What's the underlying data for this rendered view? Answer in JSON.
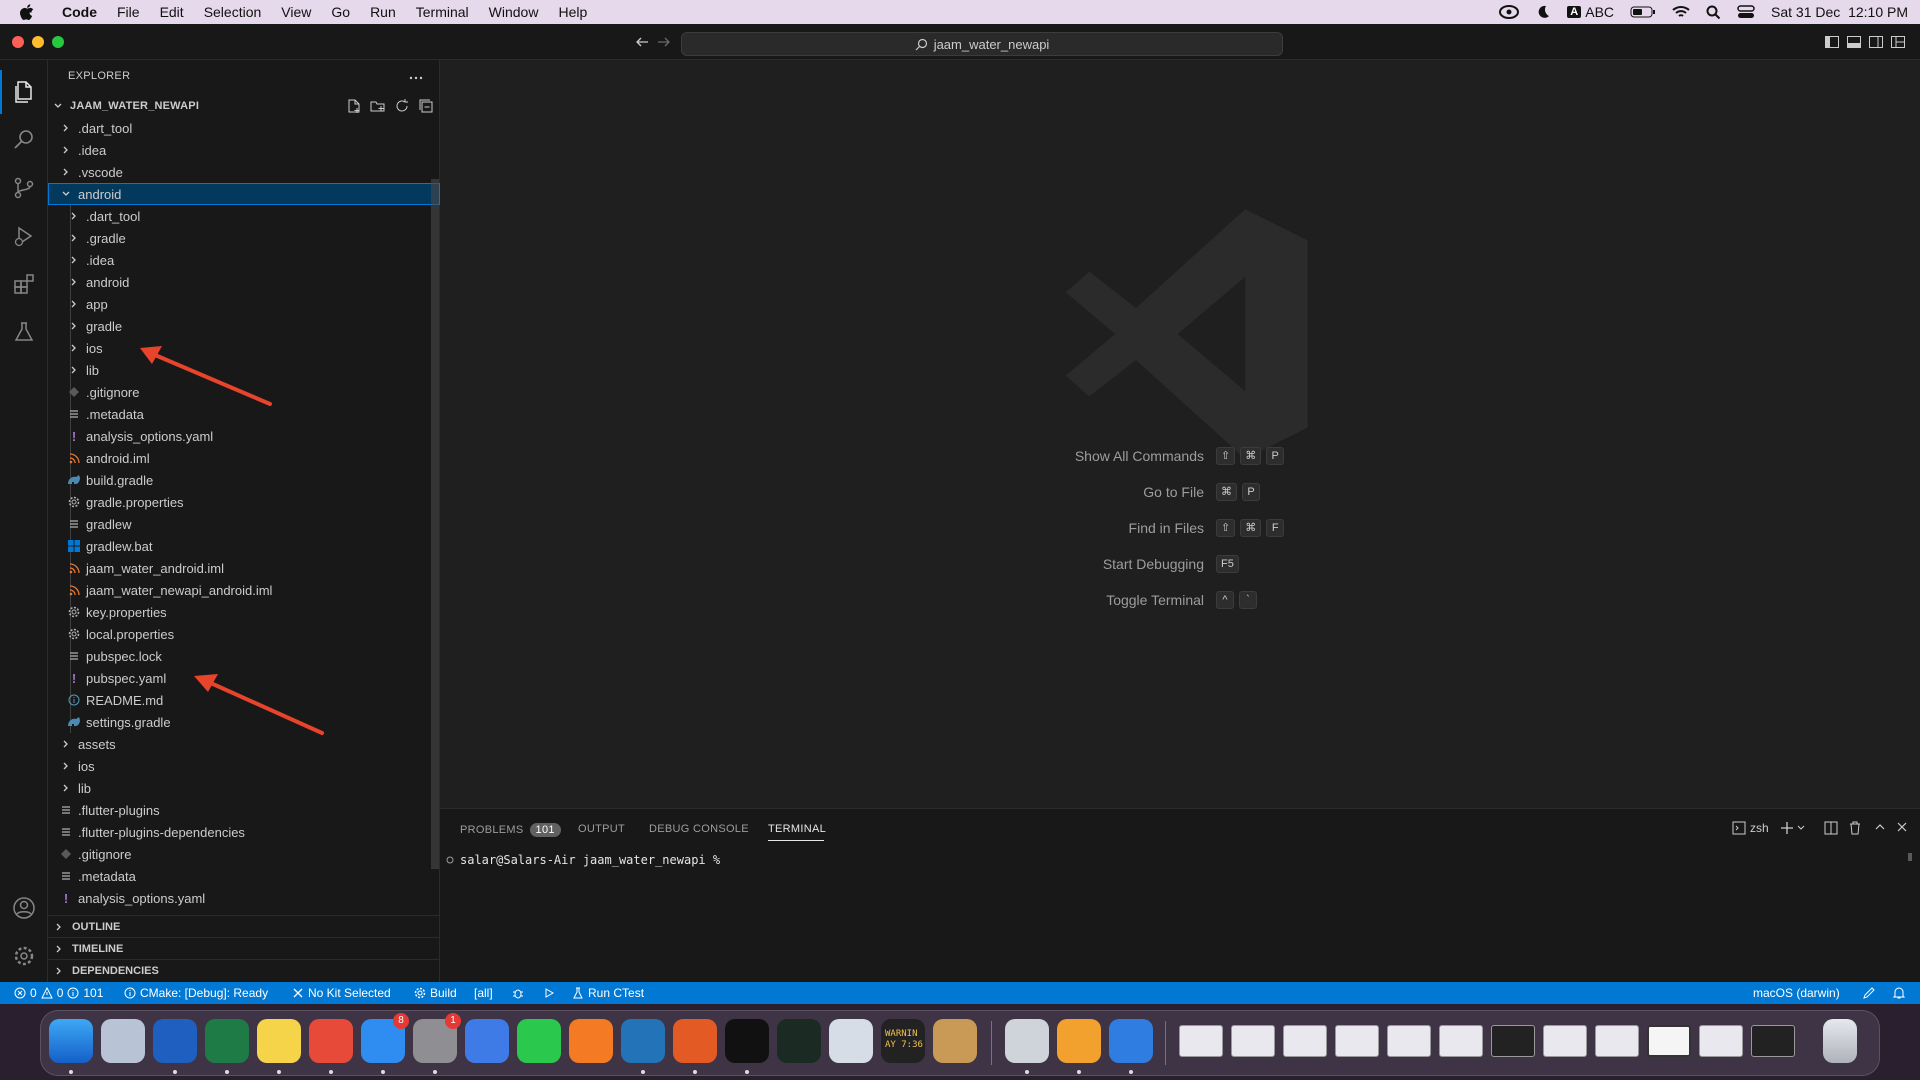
{
  "menubar": {
    "app": "Code",
    "menus": [
      "File",
      "Edit",
      "Selection",
      "View",
      "Go",
      "Run",
      "Terminal",
      "Window",
      "Help"
    ],
    "input_source": "ABC",
    "datetime": "Sat 31 Dec  12:10 PM"
  },
  "titlebar": {
    "search": "jaam_water_newapi"
  },
  "sidebar": {
    "title": "EXPLORER",
    "root": "JAAM_WATER_NEWAPI",
    "items": [
      {
        "label": ".dart_tool",
        "type": "folder",
        "depth": 1
      },
      {
        "label": ".idea",
        "type": "folder",
        "depth": 1
      },
      {
        "label": ".vscode",
        "type": "folder",
        "depth": 1
      },
      {
        "label": "android",
        "type": "folder-open",
        "depth": 1,
        "selected": true
      },
      {
        "label": ".dart_tool",
        "type": "folder",
        "depth": 2
      },
      {
        "label": ".gradle",
        "type": "folder",
        "depth": 2
      },
      {
        "label": ".idea",
        "type": "folder",
        "depth": 2
      },
      {
        "label": "android",
        "type": "folder",
        "depth": 2
      },
      {
        "label": "app",
        "type": "folder",
        "depth": 2
      },
      {
        "label": "gradle",
        "type": "folder",
        "depth": 2
      },
      {
        "label": "ios",
        "type": "folder",
        "depth": 2
      },
      {
        "label": "lib",
        "type": "folder",
        "depth": 2
      },
      {
        "label": ".gitignore",
        "type": "git",
        "depth": 2
      },
      {
        "label": ".metadata",
        "type": "lines",
        "depth": 2
      },
      {
        "label": "analysis_options.yaml",
        "type": "yaml",
        "depth": 2
      },
      {
        "label": "android.iml",
        "type": "rss",
        "depth": 2
      },
      {
        "label": "build.gradle",
        "type": "gradle",
        "depth": 2
      },
      {
        "label": "gradle.properties",
        "type": "gear",
        "depth": 2
      },
      {
        "label": "gradlew",
        "type": "lines",
        "depth": 2
      },
      {
        "label": "gradlew.bat",
        "type": "windows",
        "depth": 2
      },
      {
        "label": "jaam_water_android.iml",
        "type": "rss",
        "depth": 2
      },
      {
        "label": "jaam_water_newapi_android.iml",
        "type": "rss",
        "depth": 2
      },
      {
        "label": "key.properties",
        "type": "gear",
        "depth": 2
      },
      {
        "label": "local.properties",
        "type": "gear",
        "depth": 2
      },
      {
        "label": "pubspec.lock",
        "type": "lines",
        "depth": 2
      },
      {
        "label": "pubspec.yaml",
        "type": "yaml",
        "depth": 2
      },
      {
        "label": "README.md",
        "type": "info",
        "depth": 2
      },
      {
        "label": "settings.gradle",
        "type": "gradle",
        "depth": 2
      },
      {
        "label": "assets",
        "type": "folder",
        "depth": 1
      },
      {
        "label": "ios",
        "type": "folder",
        "depth": 1
      },
      {
        "label": "lib",
        "type": "folder",
        "depth": 1
      },
      {
        "label": ".flutter-plugins",
        "type": "lines",
        "depth": 1
      },
      {
        "label": ".flutter-plugins-dependencies",
        "type": "lines",
        "depth": 1
      },
      {
        "label": ".gitignore",
        "type": "git",
        "depth": 1
      },
      {
        "label": ".metadata",
        "type": "lines",
        "depth": 1
      },
      {
        "label": "analysis_options.yaml",
        "type": "yaml",
        "depth": 1
      }
    ],
    "sections": [
      "OUTLINE",
      "TIMELINE",
      "DEPENDENCIES"
    ]
  },
  "editor": {
    "shortcuts": [
      {
        "name": "Show All Commands",
        "keys": [
          "⇧",
          "⌘",
          "P"
        ]
      },
      {
        "name": "Go to File",
        "keys": [
          "⌘",
          "P"
        ]
      },
      {
        "name": "Find in Files",
        "keys": [
          "⇧",
          "⌘",
          "F"
        ]
      },
      {
        "name": "Start Debugging",
        "keys": [
          "F5"
        ]
      },
      {
        "name": "Toggle Terminal",
        "keys": [
          "^",
          "`"
        ]
      }
    ]
  },
  "panel": {
    "tabs": [
      "PROBLEMS",
      "OUTPUT",
      "DEBUG CONSOLE",
      "TERMINAL"
    ],
    "problems_count": "101",
    "active_tab": "TERMINAL",
    "shell": "zsh",
    "prompt": "salar@Salars-Air jaam_water_newapi %"
  },
  "status": {
    "errors": "0",
    "warnings": "0",
    "info": "101",
    "cmake": "CMake: [Debug]: Ready",
    "kit": "No Kit Selected",
    "build": "Build",
    "target": "[all]",
    "ctest": "Run CTest",
    "platform": "macOS (darwin)"
  },
  "dock": {
    "badges": [
      "8",
      "1"
    ],
    "console_text": "WARNIN\nAY 7:36"
  },
  "colors": {
    "accent": "#0078d4",
    "selection": "#04395e",
    "annotation_arrow": "#e8432b"
  }
}
